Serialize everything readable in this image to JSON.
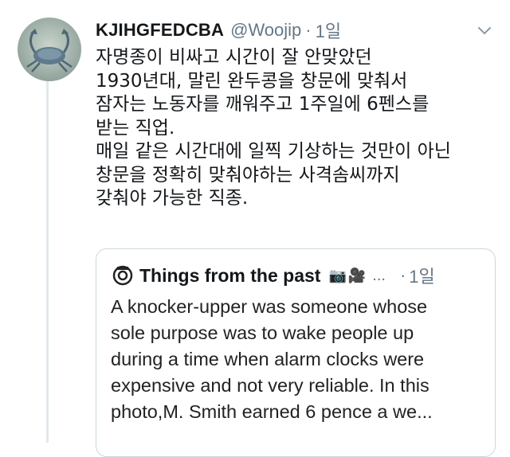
{
  "tweet": {
    "display_name": "KJIHGFEDCBA",
    "handle": "@Woojip",
    "separator": "·",
    "time": "1일",
    "lines": [
      "자명종이 비싸고 시간이 잘 안맞았던",
      "1930년대, 말린 완두콩을 창문에 맞춰서",
      "잠자는 노동자를 깨워주고 1주일에 6펜스를",
      "받는 직업.",
      "매일 같은 시간대에 일찍 기상하는 것만이 아닌",
      "창문을 정확히 맞춰야하는 사격솜씨까지",
      "갖춰야 가능한 직종."
    ]
  },
  "quoted": {
    "display_name": "Things from the past",
    "emoji": "📷🎥",
    "ellipsis": "...",
    "separator": "·",
    "time": "1일",
    "lines": [
      "A knocker-upper was someone whose",
      "sole purpose was to wake people up",
      "during a time when alarm clocks were",
      "expensive and not very reliable. In this",
      "photo,M. Smith earned 6 pence a we..."
    ]
  },
  "icons": {
    "avatar": "crab-avatar",
    "chevron": "chevron-down-icon",
    "quote_avatar": "camera-lens-icon"
  },
  "colors": {
    "text": "#14171a",
    "muted": "#657786",
    "border": "#ccd6dd"
  }
}
